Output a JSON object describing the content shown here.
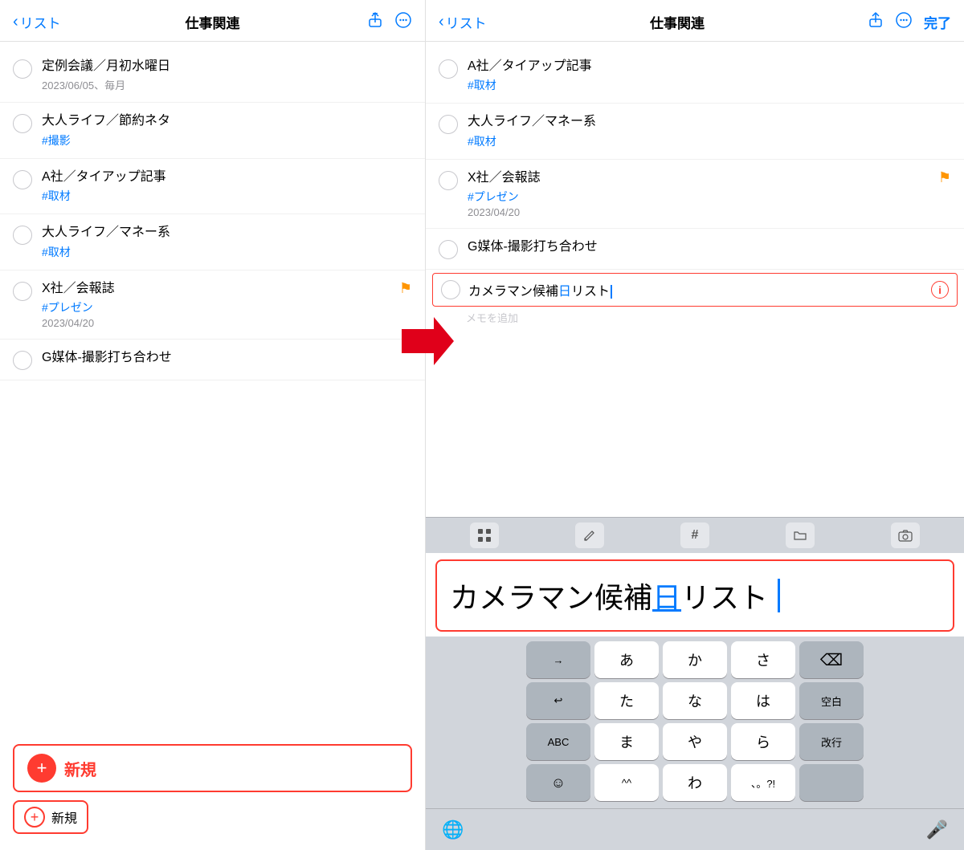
{
  "left": {
    "nav": {
      "back_label": "リスト",
      "title": "仕事関連",
      "share_icon": "↑",
      "more_icon": "•••"
    },
    "items": [
      {
        "title": "定例会議／月初水曜日",
        "subtitle": "",
        "date": "2023/06/05、毎月",
        "tag": "",
        "flag": false
      },
      {
        "title": "大人ライフ／節約ネタ",
        "subtitle": "#撮影",
        "date": "",
        "tag": "blue",
        "flag": false
      },
      {
        "title": "A社／タイアップ記事",
        "subtitle": "#取材",
        "date": "",
        "tag": "blue",
        "flag": false
      },
      {
        "title": "大人ライフ／マネー系",
        "subtitle": "#取材",
        "date": "",
        "tag": "blue",
        "flag": false
      },
      {
        "title": "X社／会報誌",
        "subtitle": "#プレゼン",
        "date": "2023/04/20",
        "tag": "blue",
        "flag": true
      },
      {
        "title": "G媒体-撮影打ち合わせ",
        "subtitle": "",
        "date": "",
        "tag": "",
        "flag": false
      }
    ],
    "new_button_label": "新規",
    "new_button_small_label": "新規"
  },
  "right": {
    "nav": {
      "back_label": "リスト",
      "title": "仕事関連",
      "share_icon": "↑",
      "more_icon": "•••",
      "done_label": "完了"
    },
    "items": [
      {
        "title": "A社／タイアップ記事",
        "subtitle": "#取材",
        "date": "",
        "tag": "blue",
        "flag": false
      },
      {
        "title": "大人ライフ／マネー系",
        "subtitle": "#取材",
        "date": "",
        "tag": "blue",
        "flag": false
      },
      {
        "title": "X社／会報誌",
        "subtitle": "#プレゼン",
        "date": "2023/04/20",
        "tag": "blue",
        "flag": true
      },
      {
        "title": "G媒体-撮影打ち合わせ",
        "subtitle": "",
        "date": "",
        "tag": "",
        "flag": false
      }
    ],
    "editing_text_part1": "カメラマン候補",
    "editing_text_highlight": "日",
    "editing_text_part2": "リスト",
    "editing_cursor": "|",
    "memo_placeholder": "メモを追加",
    "toolbar_icons": [
      "grid",
      "pencil",
      "#",
      "folder",
      "camera"
    ],
    "preview_text_part1": "カメラマン候補",
    "preview_text_highlight": "日",
    "preview_text_part2": "リスト",
    "keyboard": {
      "row1": [
        "→",
        "あ",
        "か",
        "さ",
        "⌫"
      ],
      "row2": [
        "↩",
        "た",
        "な",
        "は",
        "空白"
      ],
      "row3": [
        "ABC",
        "ま",
        "や",
        "ら",
        "改行"
      ],
      "row4": [
        "☺",
        "^^",
        "わ",
        "、。?!",
        ""
      ],
      "bottom_left": "🌐",
      "bottom_right": "🎤"
    }
  }
}
